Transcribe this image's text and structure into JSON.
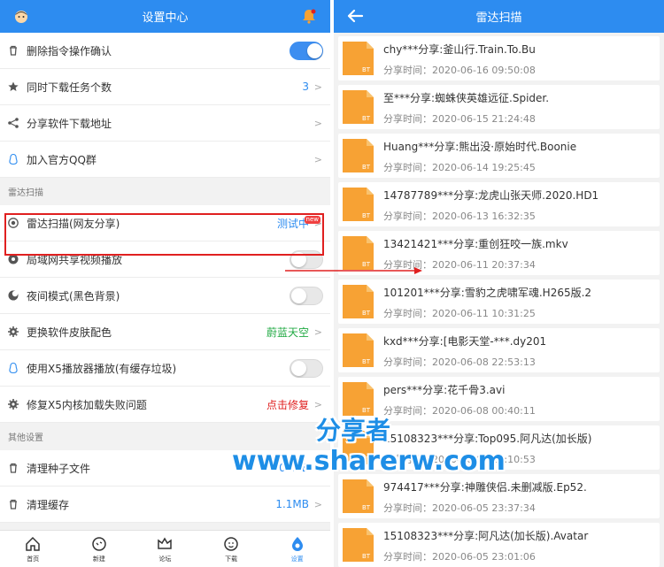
{
  "left": {
    "title": "设置中心",
    "rows_top": [
      {
        "label": "删除指令操作确认",
        "icon": "trash-icon",
        "type": "toggle",
        "on": true
      },
      {
        "label": "同时下载任务个数",
        "icon": "star-icon",
        "type": "value",
        "value": "3",
        "value_color": "#2d8cf0"
      },
      {
        "label": "分享软件下载地址",
        "icon": "share-icon",
        "type": "chevron"
      },
      {
        "label": "加入官方QQ群",
        "icon": "qq-icon",
        "type": "chevron"
      }
    ],
    "section_radar": "雷达扫描",
    "rows_radar": [
      {
        "label": "雷达扫描(网友分享)",
        "icon": "radar-icon",
        "type": "value",
        "value": "测试中",
        "value_color": "#2d8cf0",
        "badge": "new"
      },
      {
        "label": "局域网共享视频播放",
        "icon": "lan-icon",
        "type": "toggle",
        "on": false
      },
      {
        "label": "夜间模式(黑色背景)",
        "icon": "moon-icon",
        "type": "toggle",
        "on": false
      },
      {
        "label": "更换软件皮肤配色",
        "icon": "gear-icon",
        "type": "value",
        "value": "蔚蓝天空",
        "value_color": "#22aa44"
      },
      {
        "label": "使用X5播放器播放(有缓存垃圾)",
        "icon": "qq-icon",
        "type": "toggle",
        "on": false
      },
      {
        "label": "修复X5内核加载失败问题",
        "icon": "gear-icon",
        "type": "value",
        "value": "点击修复",
        "value_color": "#e02020"
      }
    ],
    "section_other": "其他设置",
    "rows_other": [
      {
        "label": "清理种子文件",
        "icon": "trash-icon",
        "type": "value",
        "value": "0.01MB",
        "value_color": "#2d8cf0"
      },
      {
        "label": "清理缓存",
        "icon": "trash-icon",
        "type": "value",
        "value": "1.1MB",
        "value_color": "#2d8cf0"
      }
    ],
    "nav": [
      {
        "label": "首页",
        "icon": "home-icon",
        "active": false
      },
      {
        "label": "新建",
        "icon": "new-icon",
        "active": false
      },
      {
        "label": "论坛",
        "icon": "crown-icon",
        "active": false
      },
      {
        "label": "下载",
        "icon": "download-icon",
        "active": false
      },
      {
        "label": "设置",
        "icon": "settings-icon",
        "active": true
      }
    ]
  },
  "right": {
    "title": "雷达扫描",
    "bt_label": "BT",
    "items": [
      {
        "title": "chy***分享:釜山行.Train.To.Bu",
        "time": "分享时间：2020-06-16 09:50:08"
      },
      {
        "title": "至***分享:蜘蛛侠英雄远征.Spider.",
        "time": "分享时间：2020-06-15 21:24:48"
      },
      {
        "title": "Huang***分享:熊出没·原始时代.Boonie",
        "time": "分享时间：2020-06-14 19:25:45"
      },
      {
        "title": "14787789***分享:龙虎山张天师.2020.HD1",
        "time": "分享时间：2020-06-13 16:32:35"
      },
      {
        "title": "13421421***分享:重创狂咬一族.mkv",
        "time": "分享时间：2020-06-11 20:37:34"
      },
      {
        "title": "101201***分享:雪豹之虎啸军魂.H265版.2",
        "time": "分享时间：2020-06-11 10:31:25"
      },
      {
        "title": "kxd***分享:[电影天堂-***.dy201",
        "time": "分享时间：2020-06-08 22:53:13"
      },
      {
        "title": "pers***分享:花千骨3.avi",
        "time": "分享时间：2020-06-08 00:40:11"
      },
      {
        "title": "15108323***分享:Top095.阿凡达(加长版)",
        "time": "分享时间：2020-06-07 11:10:53"
      },
      {
        "title": "974417***分享:神雕侠侣.未删减版.Ep52.",
        "time": "分享时间：2020-06-05 23:37:34"
      },
      {
        "title": "15108323***分享:阿凡达(加长版).Avatar",
        "time": "分享时间：2020-06-05 23:01:06"
      }
    ]
  },
  "watermark": {
    "cn": "分享者",
    "url": "www.sharerw.com"
  },
  "colors": {
    "primary": "#2d8cf0",
    "bt_orange": "#f7a234",
    "highlight_red": "#e02020"
  }
}
